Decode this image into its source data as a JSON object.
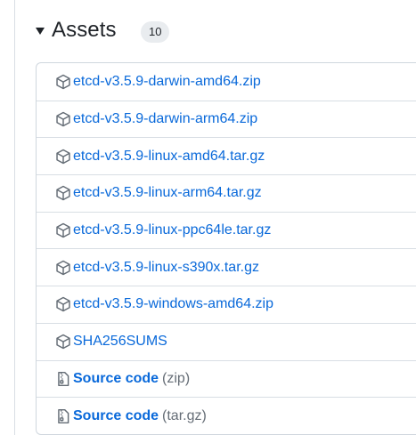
{
  "header": {
    "title": "Assets",
    "count": "10"
  },
  "assets": [
    {
      "label": "etcd-v3.5.9-darwin-amd64.zip",
      "icon": "package-icon"
    },
    {
      "label": "etcd-v3.5.9-darwin-arm64.zip",
      "icon": "package-icon"
    },
    {
      "label": "etcd-v3.5.9-linux-amd64.tar.gz",
      "icon": "package-icon"
    },
    {
      "label": "etcd-v3.5.9-linux-arm64.tar.gz",
      "icon": "package-icon"
    },
    {
      "label": "etcd-v3.5.9-linux-ppc64le.tar.gz",
      "icon": "package-icon"
    },
    {
      "label": "etcd-v3.5.9-linux-s390x.tar.gz",
      "icon": "package-icon"
    },
    {
      "label": "etcd-v3.5.9-windows-amd64.zip",
      "icon": "package-icon"
    },
    {
      "label": "SHA256SUMS",
      "icon": "package-icon"
    }
  ],
  "source": [
    {
      "label": "Source code",
      "suffix": "(zip)",
      "icon": "file-zip-icon"
    },
    {
      "label": "Source code",
      "suffix": "(tar.gz)",
      "icon": "file-zip-icon"
    }
  ],
  "colors": {
    "link": "#0969da",
    "muted": "#656d76",
    "border": "#d0d7de",
    "badge_bg": "#e9ecef"
  }
}
